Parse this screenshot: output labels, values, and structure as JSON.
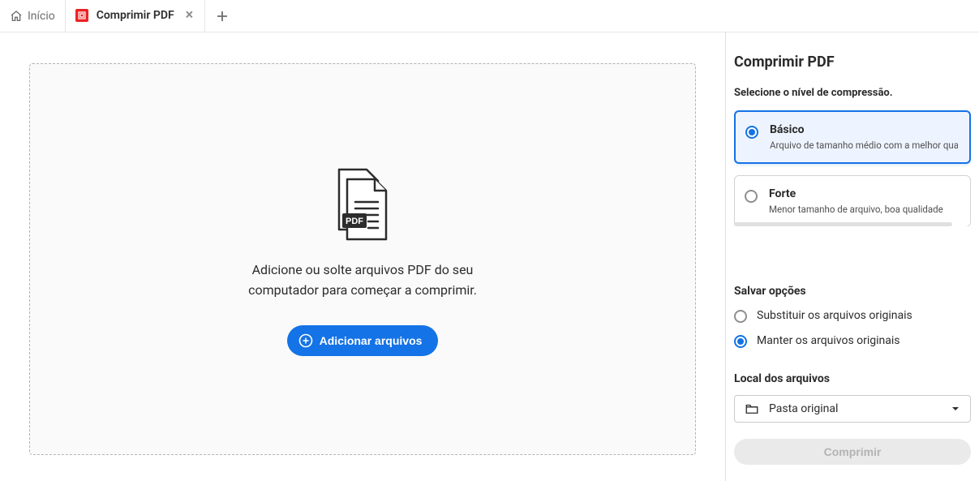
{
  "tabs": {
    "home_label": "Início",
    "active_label": "Comprimir PDF"
  },
  "drop": {
    "text": "Adicione ou solte arquivos PDF do seu computador para começar a comprimir.",
    "add_btn": "Adicionar arquivos"
  },
  "panel": {
    "title": "Comprimir PDF",
    "select_label": "Selecione o nível de compressão.",
    "options": {
      "basic": {
        "title": "Básico",
        "desc": "Arquivo de tamanho médio com a melhor qua"
      },
      "strong": {
        "title": "Forte",
        "desc": "Menor tamanho de arquivo, boa qualidade"
      }
    },
    "save_section": "Salvar opções",
    "save_options": {
      "replace": "Substituir os arquivos originais",
      "keep": "Manter os arquivos originais"
    },
    "location_label": "Local dos arquivos",
    "location_value": "Pasta original",
    "compress_btn": "Comprimir"
  }
}
